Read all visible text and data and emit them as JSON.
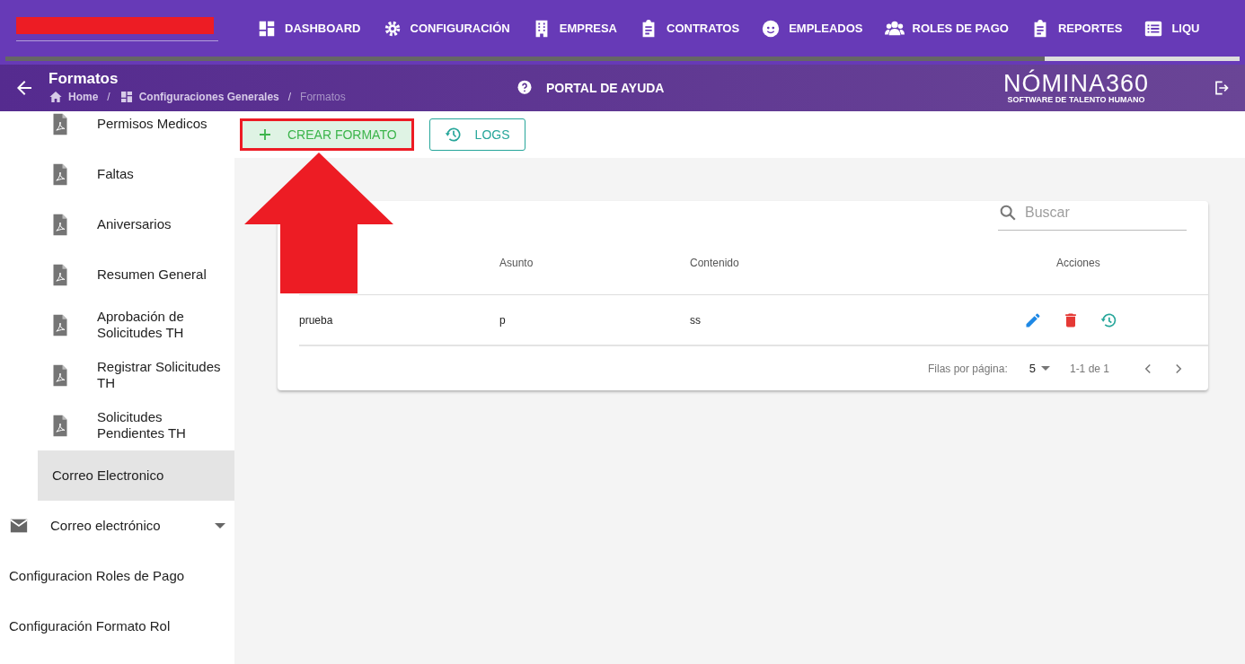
{
  "nav_items": [
    {
      "label": "DASHBOARD"
    },
    {
      "label": "CONFIGURACIÓN"
    },
    {
      "label": "EMPRESA"
    },
    {
      "label": "CONTRATOS"
    },
    {
      "label": "EMPLEADOS"
    },
    {
      "label": "ROLES DE PAGO"
    },
    {
      "label": "REPORTES"
    },
    {
      "label": "LIQU"
    }
  ],
  "page_header": {
    "title": "Formatos",
    "breadcrumb": [
      {
        "label": "Home",
        "current": false
      },
      {
        "separator": "/"
      },
      {
        "label": "Configuraciones Generales",
        "current": false
      },
      {
        "separator": "/"
      },
      {
        "label": "Formatos",
        "current": true
      }
    ],
    "help_link": "PORTAL DE AYUDA",
    "logo": {
      "name": "NÓMINA360",
      "tagline": "SOFTWARE DE TALENTO HUMANO"
    }
  },
  "sidebar": {
    "items": [
      {
        "label": "Permisos Medicos",
        "kind": "pdf",
        "selected": false
      },
      {
        "label": "Faltas",
        "kind": "pdf",
        "selected": false
      },
      {
        "label": "Aniversarios",
        "kind": "pdf",
        "selected": false
      },
      {
        "label": "Resumen General",
        "kind": "pdf",
        "selected": false
      },
      {
        "label": "Aprobación de Solicitudes TH",
        "kind": "pdf",
        "selected": false
      },
      {
        "label": "Registrar Solicitudes TH",
        "kind": "pdf",
        "selected": false
      },
      {
        "label": "Solicitudes Pendientes TH",
        "kind": "pdf",
        "selected": false
      },
      {
        "label": "Correo Electronico",
        "kind": "sub",
        "selected": true
      },
      {
        "label": "Correo electrónico",
        "kind": "group",
        "selected": false
      },
      {
        "label": "Configuracion Roles de Pago",
        "kind": "plain",
        "selected": false
      },
      {
        "label": "Configuración Formato Rol",
        "kind": "plain",
        "selected": false
      }
    ]
  },
  "toolbar": {
    "buttons": [
      {
        "label": "CREAR FORMATO",
        "kind": "create",
        "highlighted": true
      },
      {
        "label": "LOGS",
        "kind": "logs",
        "highlighted": false
      }
    ]
  },
  "table": {
    "search": {
      "placeholder": "Buscar"
    },
    "columns": [
      "",
      "Asunto",
      "Contenido",
      "Acciones"
    ],
    "rows": [
      {
        "cells": [
          "prueba",
          "p",
          "ss"
        ]
      }
    ],
    "pagination": {
      "rows_per_page_label": "Filas por página:",
      "rows_per_page": "5",
      "range": "1-1 de 1"
    }
  }
}
